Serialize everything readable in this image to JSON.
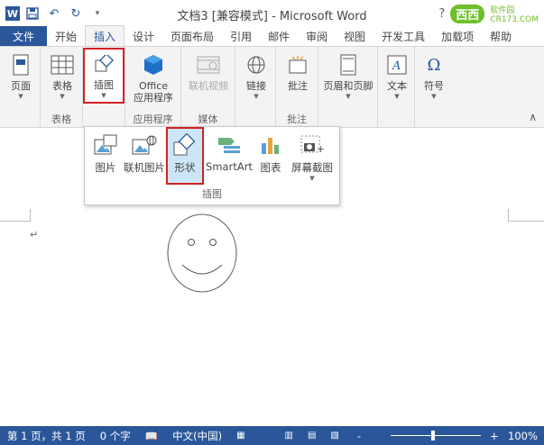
{
  "window": {
    "title": "文档3 [兼容模式] - Microsoft Word",
    "help": "?",
    "site_logo": "西西",
    "site_sub": "软件园",
    "site_url": "CR173.COM"
  },
  "tabs": [
    "文件",
    "开始",
    "插入",
    "设计",
    "页面布局",
    "引用",
    "邮件",
    "审阅",
    "视图",
    "开发工具",
    "加载项",
    "帮助"
  ],
  "ribbon": {
    "page_label": "页面",
    "table_label": "表格",
    "table_group": "表格",
    "illustrations_label": "插图",
    "office_label_1": "Office",
    "office_label_2": "应用程序",
    "apps_group": "应用程序",
    "online_video_label": "联机视频",
    "media_group": "媒体",
    "link_label": "链接",
    "comment_label": "批注",
    "comment_group": "批注",
    "header_footer_label": "页眉和页脚",
    "text_label": "文本",
    "symbol_label": "符号"
  },
  "dropdown": {
    "items": [
      "图片",
      "联机图片",
      "形状",
      "SmartArt",
      "图表",
      "屏幕截图"
    ],
    "group_label": "插图"
  },
  "status": {
    "page": "第 1 页，共 1 页",
    "words": "0 个字",
    "language": "中文(中国)",
    "zoom": "100%",
    "zoom_minus": "-",
    "zoom_plus": "+"
  },
  "colors": {
    "accent": "#2b579a",
    "highlight": "#d32323",
    "logo_green": "#6fbf2b"
  }
}
